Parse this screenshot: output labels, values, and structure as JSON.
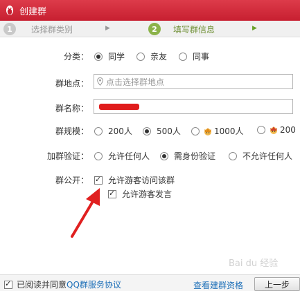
{
  "window": {
    "title": "创建群"
  },
  "steps": [
    {
      "num": "1",
      "label": "选择群类别"
    },
    {
      "num": "2",
      "label": "填写群信息"
    }
  ],
  "form": {
    "category": {
      "label": "分类：",
      "options": [
        "同学",
        "亲友",
        "同事"
      ],
      "selected": "同学"
    },
    "location": {
      "label": "群地点：",
      "placeholder": "点击选择群地点"
    },
    "name": {
      "label": "群名称："
    },
    "size": {
      "label": "群规模：",
      "options": [
        "200人",
        "500人",
        "1000人",
        "200"
      ],
      "selected": "500人"
    },
    "verify": {
      "label": "加群验证：",
      "options": [
        "允许任何人",
        "需身份验证",
        "不允许任何人"
      ],
      "selected": "需身份验证"
    },
    "public": {
      "label": "群公开：",
      "allow_visit": "允许游客访问该群",
      "allow_speak": "允许游客发言",
      "allow_visit_checked": true,
      "allow_speak_checked": true
    }
  },
  "footer": {
    "agree_prefix": "已阅读并同意",
    "agree_link": "QQ群服务协议",
    "agree_checked": true,
    "view_qualification": "查看建群资格",
    "prev_button": "上一步"
  },
  "watermark": "Bai du 经验",
  "colors": {
    "titlebar": "#c71f30",
    "link": "#1d6fb8",
    "active_step": "#8cb34a",
    "annotation_arrow": "#e02020"
  },
  "icons": [
    "qq-penguin-icon",
    "location-pin-icon",
    "crown-icon",
    "arrow-annotation"
  ]
}
